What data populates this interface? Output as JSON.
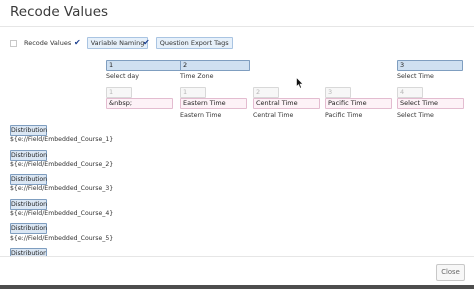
{
  "dialog": {
    "title": "Recode Values"
  },
  "options": {
    "recode_values": {
      "label": "Recode Values",
      "checked": false
    },
    "variable_naming": {
      "label": "Variable Naming",
      "checked": true
    },
    "question_export_tags": {
      "label": "Question Export Tags",
      "checked": true
    }
  },
  "columns": [
    {
      "recode": "1",
      "label": "Select day",
      "var_value": "1",
      "text_value": "&nbsp;",
      "text_label": ""
    },
    {
      "recode": "2",
      "label": "Time Zone",
      "var_value": "1",
      "text_value": "Eastern Time",
      "text_label": "Eastern Time"
    },
    {
      "var_value": "2",
      "text_value": "Central Time",
      "text_label": "Central Time"
    },
    {
      "var_value": "3",
      "text_value": "Pacific Time",
      "text_label": "Pacific Time"
    },
    {
      "recode": "3",
      "label": "Select Time",
      "var_value": "4",
      "text_value": "Select Time",
      "text_label": "Select Time"
    }
  ],
  "embedded_fields": [
    {
      "button": "Distribution",
      "field": "${e://Field/Embedded_Course_1}"
    },
    {
      "button": "Distribution",
      "field": "${e://Field/Embedded_Course_2}"
    },
    {
      "button": "Distribution",
      "field": "${e://Field/Embedded_Course_3}"
    },
    {
      "button": "Distribution",
      "field": "${e://Field/Embedded_Course_4}"
    },
    {
      "button": "Distribution",
      "field": "${e://Field/Embedded_Course_5}"
    },
    {
      "button": "Distribution",
      "field": ""
    }
  ],
  "footer": {
    "close_label": "Close"
  },
  "icons": {
    "check": "check-icon",
    "cursor": "mouse-pointer-icon"
  }
}
